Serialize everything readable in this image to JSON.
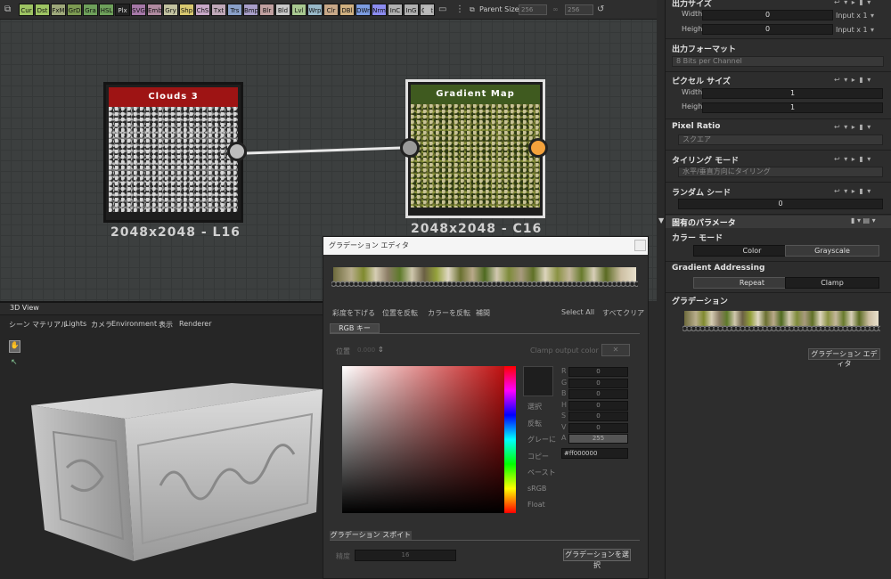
{
  "toolbar": {
    "buttons": [
      {
        "label": "Cur",
        "color": "#9ec463"
      },
      {
        "label": "Dst",
        "color": "#9ec463"
      },
      {
        "label": "FxM",
        "color": "#9ea87a"
      },
      {
        "label": "GrD",
        "color": "#7c9a52"
      },
      {
        "label": "Gra",
        "color": "#6ea05a"
      },
      {
        "label": "HSL",
        "color": "#6ea05a"
      },
      {
        "label": "Plx",
        "color": "#222222"
      },
      {
        "label": "SVG",
        "color": "#a678a8"
      },
      {
        "label": "Emb",
        "color": "#b08aa0"
      },
      {
        "label": "Gry",
        "color": "#c2c2a0"
      },
      {
        "label": "Shp",
        "color": "#d8c870"
      },
      {
        "label": "ChS",
        "color": "#c8a8c8"
      },
      {
        "label": "Txt",
        "color": "#c0a8b8"
      },
      {
        "label": "Trs",
        "color": "#8aa0c8"
      },
      {
        "label": "Bmp",
        "color": "#a89ec8"
      },
      {
        "label": "Blr",
        "color": "#c0a0a0"
      },
      {
        "label": "Bld",
        "color": "#c8c8c8"
      },
      {
        "label": "Lvl",
        "color": "#a8c890"
      },
      {
        "label": "Wrp",
        "color": "#98b8c8"
      },
      {
        "label": "Clr",
        "color": "#c8a888"
      },
      {
        "label": "DBl",
        "color": "#d0b080"
      },
      {
        "label": "DWr",
        "color": "#7c9ce0"
      },
      {
        "label": "Nrm",
        "color": "#8c8cf0"
      },
      {
        "label": "InC",
        "color": "#b0b0b0"
      },
      {
        "label": "InG",
        "color": "#b0b0b0"
      },
      {
        "label": "Out",
        "color": "#b0b0b0"
      }
    ],
    "parent_size_label": "Parent Size:",
    "parent_w": "256",
    "parent_h": "256"
  },
  "nodes": {
    "clouds": {
      "title": "Clouds 3",
      "size": "2048x2048 - L16",
      "title_color": "#9e1414"
    },
    "gradmap": {
      "title": "Gradient Map",
      "size": "2048x2048 - C16",
      "title_color": "#3f5a1f"
    }
  },
  "view3d": {
    "title": "3D View",
    "menu": [
      "シーン",
      "マテリアル",
      "Lights",
      "カメラ",
      "Environment",
      "表示",
      "Renderer"
    ]
  },
  "editor": {
    "title": "グラデーション エディタ",
    "actions": [
      "彩度を下げる",
      "位置を反転",
      "カラーを反転",
      "補間",
      "Select All",
      "すべてクリア"
    ],
    "tab_rgb": "RGB キー",
    "pos_label": "位置",
    "pos_value": "0.000",
    "clamp_label": "Clamp output color",
    "clamp_btn": "✕",
    "side": [
      "選択",
      "反転",
      "グレーに",
      "コピー",
      "ペースト",
      "sRGB",
      "Float"
    ],
    "channels": [
      {
        "k": "R",
        "v": "0"
      },
      {
        "k": "G",
        "v": "0"
      },
      {
        "k": "B",
        "v": "0"
      },
      {
        "k": "H",
        "v": "0"
      },
      {
        "k": "S",
        "v": "0"
      },
      {
        "k": "V",
        "v": "0"
      },
      {
        "k": "A",
        "v": "255"
      }
    ],
    "hex": "#ff000000",
    "tab_picker": "グラデーション スポイト",
    "precision_label": "精度",
    "precision_value": "16",
    "select_btn": "グラデーションを選択"
  },
  "panel": {
    "output_size": {
      "title": "出力サイズ",
      "width_label": "Width",
      "height_label": "Height",
      "width_val": "0",
      "height_val": "0",
      "width_suffix": "Input x 1",
      "height_suffix": "Input x 1"
    },
    "output_format": {
      "title": "出力フォーマット",
      "value": "8 Bits per Channel"
    },
    "pixel_size": {
      "title": "ピクセル サイズ",
      "width_label": "Width",
      "height_label": "Height",
      "width_val": "1",
      "height_val": "1"
    },
    "pixel_ratio": {
      "title": "Pixel Ratio",
      "value": "スクエア"
    },
    "tiling": {
      "title": "タイリング モード",
      "value": "水平/垂直方向にタイリング"
    },
    "seed": {
      "title": "ランダム シード",
      "value": "0"
    },
    "specific": {
      "title": "固有のパラメータ"
    },
    "color_mode": {
      "title": "カラー モード",
      "opt1": "Color",
      "opt2": "Grayscale"
    },
    "addressing": {
      "title": "Gradient Addressing",
      "opt1": "Repeat",
      "opt2": "Clamp"
    },
    "gradient": {
      "title": "グラデーション",
      "editor_btn": "グラデーション エディタ"
    }
  }
}
